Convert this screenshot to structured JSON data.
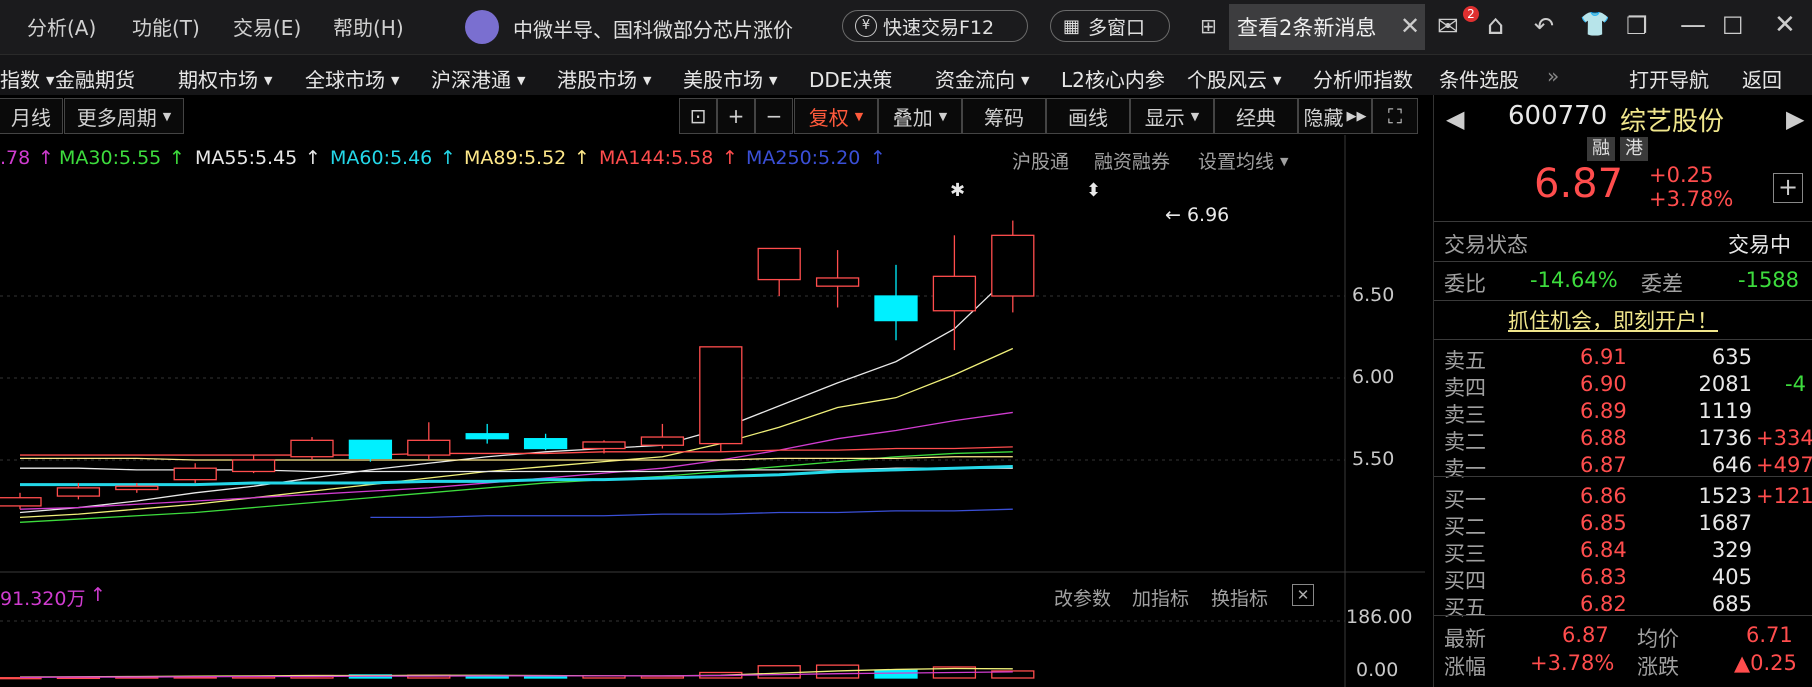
{
  "menu": {
    "analysis": "分析(A)",
    "function": "功能(T)",
    "trade": "交易(E)",
    "help": "帮助(H)"
  },
  "news_ticker": "中微半导、国科微部分芯片涨价",
  "quick_trade": "快速交易F12",
  "multi_window": "多窗口",
  "new_messages": "查看2条新消息",
  "mail_badge": "2",
  "nav_items": [
    {
      "label": "指数",
      "caret": true
    },
    {
      "label": "金融期货",
      "caret": false
    },
    {
      "label": "期权市场",
      "caret": true
    },
    {
      "label": "全球市场",
      "caret": true
    },
    {
      "label": "沪深港通",
      "caret": true
    },
    {
      "label": "港股市场",
      "caret": true
    },
    {
      "label": "美股市场",
      "caret": true
    },
    {
      "label": "DDE决策",
      "caret": false
    },
    {
      "label": "资金流向",
      "caret": true
    },
    {
      "label": "L2核心内参",
      "caret": false
    },
    {
      "label": "个股风云",
      "caret": true
    },
    {
      "label": "分析师指数",
      "caret": false
    },
    {
      "label": "条件选股",
      "caret": false
    }
  ],
  "nav_more": "»",
  "open_nav": "打开导航",
  "back": "返回",
  "toolbar": {
    "period": "月线",
    "more_periods": "更多周期",
    "fuquan": "复权",
    "overlay": "叠加",
    "chips": "筹码",
    "draw": "画线",
    "display": "显示",
    "classic": "经典",
    "hide": "隐藏"
  },
  "ma_values": {
    "ma_cut": ".78",
    "ma30": "MA30:5.55",
    "ma55": "MA55:5.45",
    "ma60": "MA60:5.46",
    "ma89": "MA89:5.52",
    "ma144": "MA144:5.58",
    "ma250": "MA250:5.20"
  },
  "chart_links": {
    "hsgt": "沪股通",
    "margin": "融资融券",
    "set_ma": "设置均线"
  },
  "price_axis": [
    "6.50",
    "6.00",
    "5.50"
  ],
  "high_label": "6.96",
  "volume": {
    "label": "91.320万",
    "edit_params": "改参数",
    "add_indicator": "加指标",
    "switch_indicator": "换指标",
    "axis_top": "186.00",
    "axis_bottom": "0.00"
  },
  "colors": {
    "up": "#ff4d4d",
    "down": "#00f0ff",
    "ma5": "#e8e8e8",
    "ma10": "#f0f07a",
    "ma20": "#d03cd0",
    "ma30": "#3ddc3d",
    "ma55": "#e8e8e8",
    "ma60": "#24d7e8",
    "ma89": "#ffe98a",
    "ma144": "#ff4d4d",
    "ma250": "#3a4fd6"
  },
  "chart_data": {
    "type": "candlestick",
    "candles": [
      {
        "open": 5.22,
        "close": 5.27,
        "high": 5.3,
        "low": 5.2
      },
      {
        "open": 5.28,
        "close": 5.33,
        "high": 5.36,
        "low": 5.26
      },
      {
        "open": 5.32,
        "close": 5.34,
        "high": 5.36,
        "low": 5.3
      },
      {
        "open": 5.38,
        "close": 5.45,
        "high": 5.48,
        "low": 5.36
      },
      {
        "open": 5.43,
        "close": 5.5,
        "high": 5.53,
        "low": 5.42
      },
      {
        "open": 5.52,
        "close": 5.62,
        "high": 5.64,
        "low": 5.5
      },
      {
        "open": 5.62,
        "close": 5.51,
        "high": 5.62,
        "low": 5.49
      },
      {
        "open": 5.53,
        "close": 5.62,
        "high": 5.73,
        "low": 5.5
      },
      {
        "open": 5.66,
        "close": 5.63,
        "high": 5.72,
        "low": 5.6
      },
      {
        "open": 5.63,
        "close": 5.57,
        "high": 5.66,
        "low": 5.56
      },
      {
        "open": 5.57,
        "close": 5.61,
        "high": 5.62,
        "low": 5.54
      },
      {
        "open": 5.59,
        "close": 5.64,
        "high": 5.72,
        "low": 5.57
      },
      {
        "open": 5.6,
        "close": 6.19,
        "high": 6.19,
        "low": 5.55
      },
      {
        "open": 6.6,
        "close": 6.79,
        "high": 6.79,
        "low": 6.5
      },
      {
        "open": 6.56,
        "close": 6.61,
        "high": 6.78,
        "low": 6.43
      },
      {
        "open": 6.5,
        "close": 6.35,
        "high": 6.69,
        "low": 6.23
      },
      {
        "open": 6.41,
        "close": 6.62,
        "high": 6.87,
        "low": 6.17
      },
      {
        "open": 6.5,
        "close": 6.87,
        "high": 6.96,
        "low": 6.4
      }
    ],
    "volumes": [
      1,
      2,
      3,
      4,
      5,
      8,
      10,
      9,
      7,
      6,
      7,
      6,
      18,
      40,
      42,
      25,
      36,
      23
    ],
    "ma_series": {
      "ma5": [
        5.18,
        5.21,
        5.25,
        5.3,
        5.34,
        5.39,
        5.44,
        5.48,
        5.52,
        5.55,
        5.57,
        5.59,
        5.69,
        5.83,
        5.97,
        6.1,
        6.3,
        6.64
      ],
      "ma10": [
        5.15,
        5.17,
        5.2,
        5.23,
        5.27,
        5.31,
        5.35,
        5.39,
        5.43,
        5.46,
        5.49,
        5.52,
        5.6,
        5.7,
        5.82,
        5.88,
        6.02,
        6.18
      ],
      "ma20": [
        5.2,
        5.21,
        5.23,
        5.25,
        5.27,
        5.29,
        5.31,
        5.33,
        5.36,
        5.39,
        5.42,
        5.45,
        5.5,
        5.56,
        5.63,
        5.68,
        5.74,
        5.79
      ],
      "ma30": [
        5.12,
        5.14,
        5.16,
        5.18,
        5.21,
        5.24,
        5.27,
        5.3,
        5.33,
        5.36,
        5.38,
        5.4,
        5.43,
        5.46,
        5.49,
        5.52,
        5.54,
        5.55
      ],
      "ma55": [
        5.45,
        5.45,
        5.44,
        5.44,
        5.44,
        5.43,
        5.43,
        5.43,
        5.43,
        5.43,
        5.43,
        5.43,
        5.44,
        5.44,
        5.44,
        5.45,
        5.45,
        5.45
      ],
      "ma60": [
        5.35,
        5.35,
        5.35,
        5.35,
        5.36,
        5.36,
        5.36,
        5.37,
        5.37,
        5.38,
        5.38,
        5.39,
        5.4,
        5.41,
        5.43,
        5.44,
        5.45,
        5.46
      ],
      "ma89": [
        5.51,
        5.51,
        5.51,
        5.5,
        5.5,
        5.5,
        5.5,
        5.5,
        5.5,
        5.5,
        5.5,
        5.5,
        5.5,
        5.51,
        5.51,
        5.51,
        5.52,
        5.52
      ],
      "ma144": [
        5.53,
        5.53,
        5.53,
        5.53,
        5.53,
        5.53,
        5.53,
        5.54,
        5.54,
        5.54,
        5.55,
        5.55,
        5.55,
        5.56,
        5.56,
        5.57,
        5.57,
        5.58
      ],
      "ma250": [
        null,
        null,
        null,
        null,
        null,
        null,
        5.15,
        5.15,
        5.16,
        5.16,
        5.16,
        5.17,
        5.17,
        5.18,
        5.18,
        5.19,
        5.19,
        5.2
      ]
    },
    "vol_ma5": [
      3,
      4,
      5,
      6,
      7,
      8,
      8,
      9,
      9,
      8,
      7,
      7,
      9,
      16,
      23,
      28,
      31,
      30
    ],
    "vol_ma10": [
      2,
      3,
      3,
      4,
      5,
      5,
      6,
      6,
      7,
      7,
      7,
      7,
      8,
      11,
      14,
      16,
      18,
      20
    ],
    "price_range": [
      5.1,
      7.1
    ],
    "volume_range": [
      0,
      186
    ]
  },
  "quote": {
    "prev": "◀",
    "next": "▶",
    "code": "600770",
    "name": "综艺股份",
    "tag1": "融",
    "tag2": "港",
    "price": "6.87",
    "change": "+0.25",
    "pct": "+3.78%",
    "add": "+",
    "status_label": "交易状态",
    "status": "交易中",
    "wb_label": "委比",
    "wb": "-14.64%",
    "wc_label": "委差",
    "wc": "-1588",
    "promo": "抓住机会，即刻开户！",
    "asks": [
      {
        "label": "卖五",
        "price": "6.91",
        "vol": "635",
        "diff": ""
      },
      {
        "label": "卖四",
        "price": "6.90",
        "vol": "2081",
        "diff": "-4"
      },
      {
        "label": "卖三",
        "price": "6.89",
        "vol": "1119",
        "diff": ""
      },
      {
        "label": "卖二",
        "price": "6.88",
        "vol": "1736",
        "diff": "+334"
      },
      {
        "label": "卖一",
        "price": "6.87",
        "vol": "646",
        "diff": "+497"
      }
    ],
    "bids": [
      {
        "label": "买一",
        "price": "6.86",
        "vol": "1523",
        "diff": "+121"
      },
      {
        "label": "买二",
        "price": "6.85",
        "vol": "1687",
        "diff": ""
      },
      {
        "label": "买三",
        "price": "6.84",
        "vol": "329",
        "diff": ""
      },
      {
        "label": "买四",
        "price": "6.83",
        "vol": "405",
        "diff": ""
      },
      {
        "label": "买五",
        "price": "6.82",
        "vol": "685",
        "diff": ""
      }
    ],
    "last_label": "最新",
    "last": "6.87",
    "avg_label": "均价",
    "avg": "6.71",
    "chg_pct_label": "涨幅",
    "chg_pct": "+3.78%",
    "chg_label": "涨跌",
    "chg": "▲0.25"
  }
}
